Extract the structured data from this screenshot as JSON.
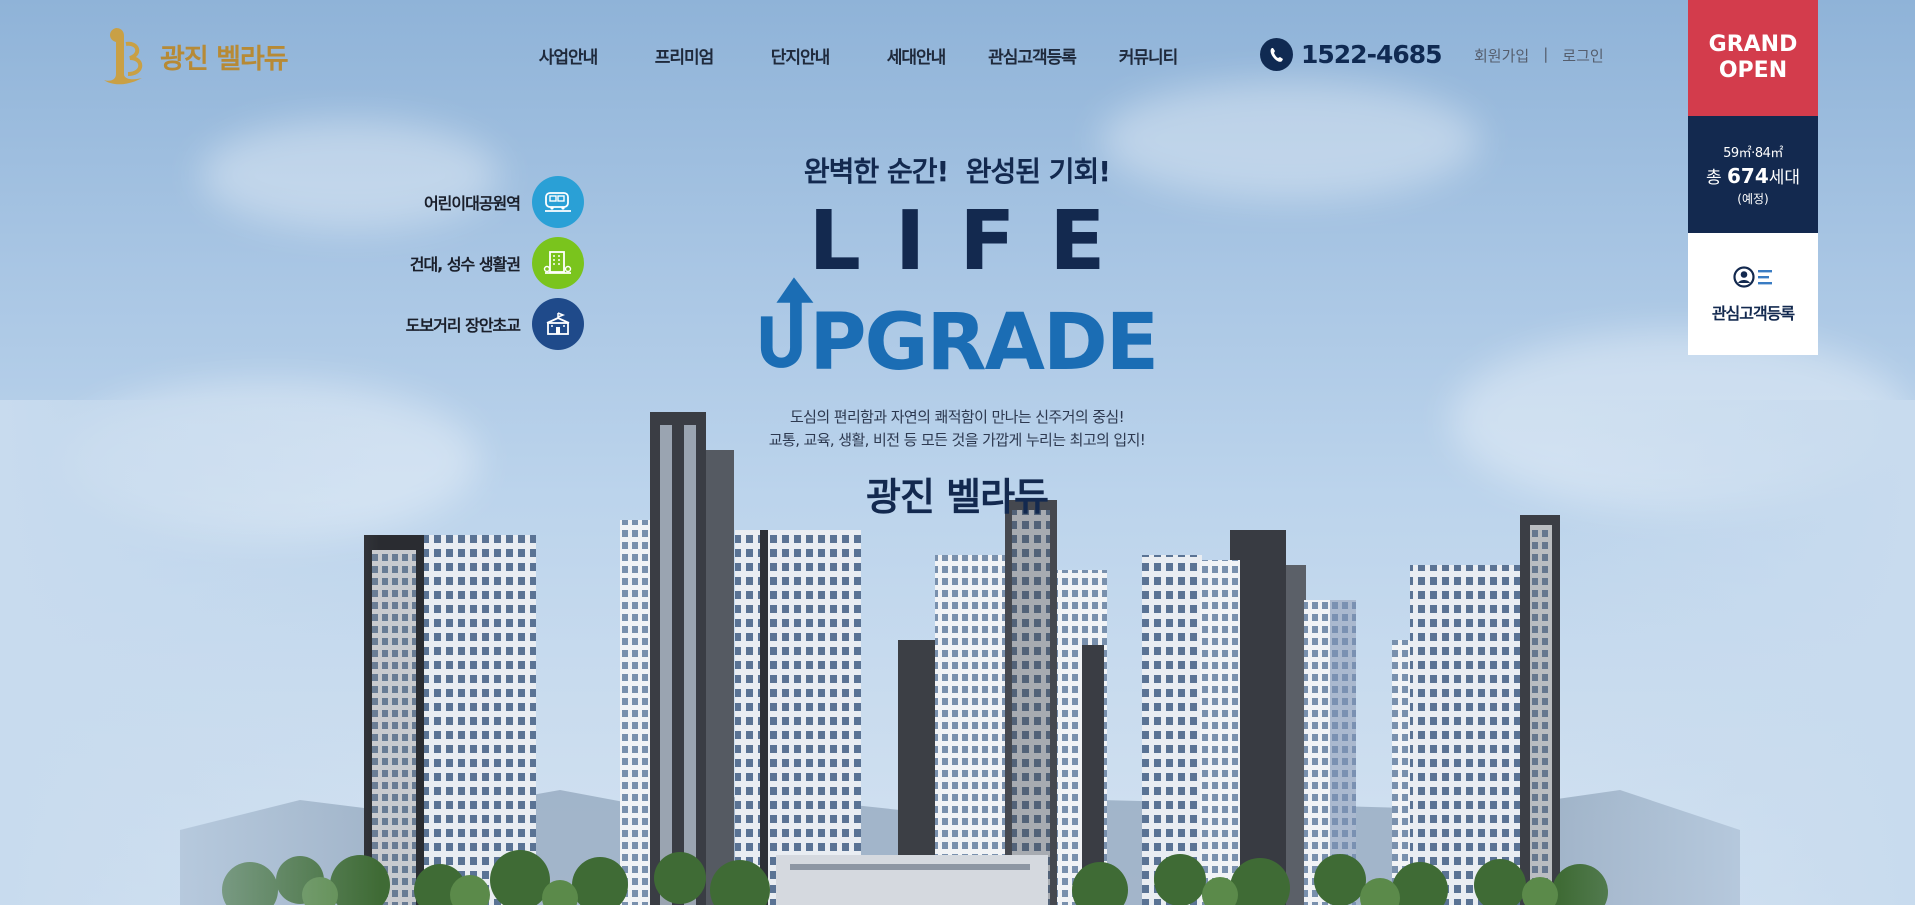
{
  "header": {
    "logo_text": "광진 벨라듀",
    "nav": [
      "사업안내",
      "프리미엄",
      "단지안내",
      "세대안내",
      "관심고객등록",
      "커뮤니티"
    ],
    "phone": "1522-4685",
    "member": {
      "join": "회원가입",
      "separator": "|",
      "login": "로그인"
    }
  },
  "quick_panel": {
    "grand_line1": "GRAND",
    "grand_line2": "OPEN",
    "area": "59㎡·84㎡",
    "total_prefix": "총 ",
    "total_count": "674",
    "total_suffix": "세대",
    "note": "(예정)",
    "register_label": "관심고객등록"
  },
  "features": [
    {
      "label": "어린이대공원역",
      "icon": "train-icon",
      "color": "#2aa0d6"
    },
    {
      "label": "건대, 성수 생활권",
      "icon": "buildings-icon",
      "color": "#7ac41d"
    },
    {
      "label": "도보거리 장안초교",
      "icon": "school-icon",
      "color": "#1f4a8a"
    }
  ],
  "hero": {
    "tagline": "완벽한 순간!  완성된 기회!",
    "life": "LIFE",
    "upgrade": "PGRADE",
    "desc_line1": "도심의 편리함과 자연의 쾌적함이 만나는 신주거의 중심!",
    "desc_line2": "교통, 교육, 생활, 비전 등 모든 것을 가깝게 누리는 최고의 입지!",
    "brand": "광진 벨라듀"
  },
  "colors": {
    "navy": "#13294f",
    "accent_red": "#d33c4c",
    "upgrade_blue": "#1b6db4",
    "logo_gold": "#b78a35"
  }
}
